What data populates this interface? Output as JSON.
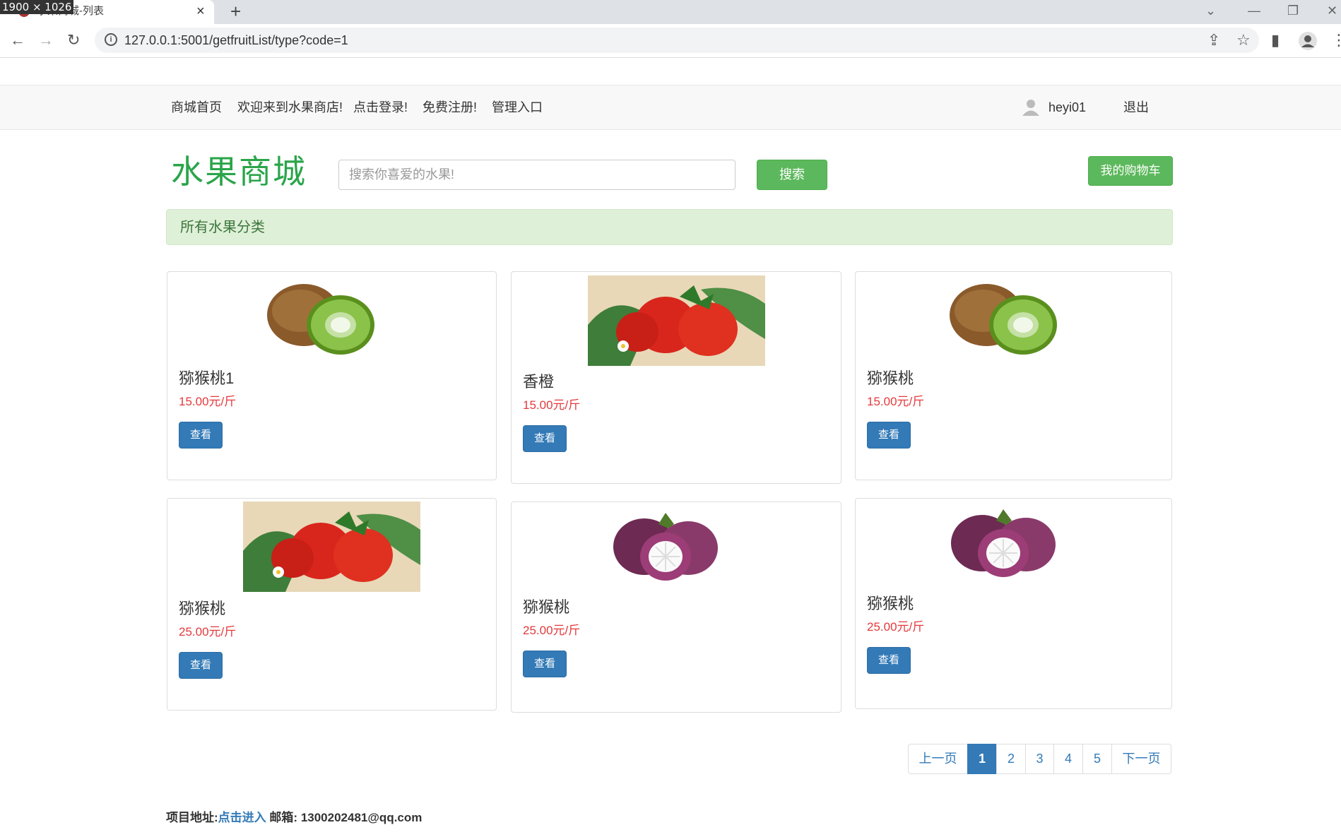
{
  "browser": {
    "dimensions_badge": "1900 × 1026",
    "tab_title": "水果商城-列表",
    "url": "127.0.0.1:5001/getfruitList/type?code=1"
  },
  "topnav": {
    "home": "商城首页",
    "welcome": "欢迎来到水果商店!",
    "login": "点击登录!",
    "register": "免费注册!",
    "admin": "管理入口",
    "username": "heyi01",
    "logout": "退出"
  },
  "header": {
    "logo": "水果商城",
    "search_placeholder": "搜索你喜爱的水果!",
    "search_button": "搜索",
    "cart_button": "我的购物车"
  },
  "category_bar": "所有水果分类",
  "view_label": "查看",
  "products": [
    {
      "name": "猕猴桃1",
      "price": "15.00元/斤",
      "image": "kiwi"
    },
    {
      "name": "香橙",
      "price": "15.00元/斤",
      "image": "strawberry"
    },
    {
      "name": "猕猴桃",
      "price": "15.00元/斤",
      "image": "kiwi"
    },
    {
      "name": "猕猴桃",
      "price": "25.00元/斤",
      "image": "strawberry"
    },
    {
      "name": "猕猴桃",
      "price": "25.00元/斤",
      "image": "mangosteen"
    },
    {
      "name": "猕猴桃",
      "price": "25.00元/斤",
      "image": "mangosteen"
    }
  ],
  "pagination": {
    "prev": "上一页",
    "pages": [
      "1",
      "2",
      "3",
      "4",
      "5"
    ],
    "active": "1",
    "next": "下一页"
  },
  "footer": {
    "project_label": "项目地址:",
    "project_link": "点击进入",
    "email_label": "邮箱:",
    "email": "1300202481@qq.com"
  },
  "colors": {
    "brand_green": "#2aa54a",
    "button_green": "#5cb85c",
    "primary_blue": "#337ab7",
    "price_red": "#e4393c"
  }
}
